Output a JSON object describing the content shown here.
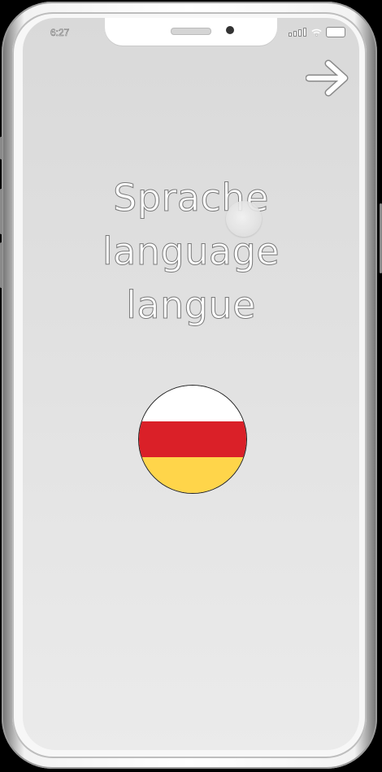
{
  "status_bar": {
    "time": "6:27",
    "icons": [
      "signal-icon",
      "wifi-icon",
      "battery-icon"
    ]
  },
  "header": {
    "next_icon": "arrow-right-icon"
  },
  "title": {
    "lines": [
      "Sprache",
      "language",
      "langue"
    ]
  },
  "language_flag": {
    "icon": "flag-icon",
    "colors": [
      "#ffffff",
      "#da2028",
      "#ffd54a"
    ]
  },
  "colors": {
    "screen_background": "#dedede",
    "text_fill": "#ffffff",
    "text_outline": "#7a7a7a"
  }
}
